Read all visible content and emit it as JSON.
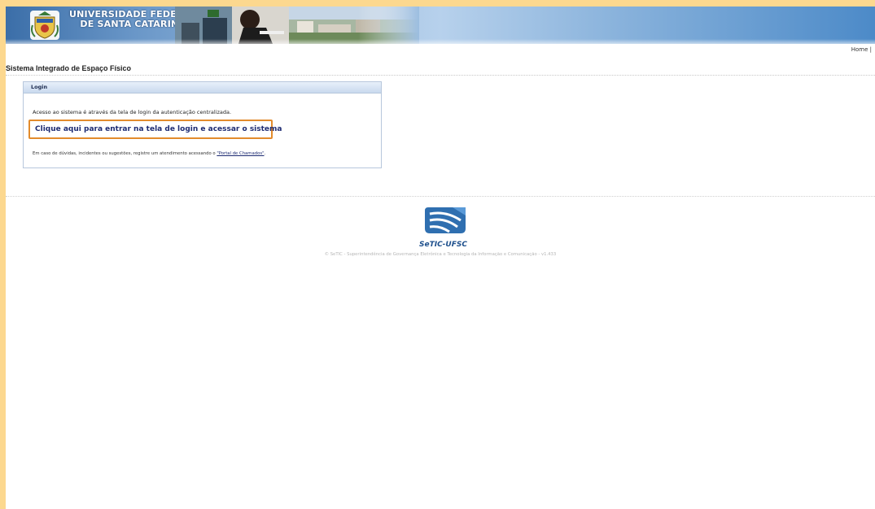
{
  "header": {
    "university_line1": "UNIVERSIDADE FEDERAL",
    "university_line2": "DE SANTA CATARINA",
    "home_link": "Home |"
  },
  "page": {
    "title": "Sistema Integrado de Espaço Físico"
  },
  "login": {
    "box_title": "Login",
    "info_text": "Acesso ao sistema é através da tela de login da autenticação centralizada.",
    "link_text": "Clique aqui para entrar na tela de login e acessar o sistema",
    "support_prefix": "Em caso de dúvidas, incidentes ou sugestões, registre um atendimento acessando o ",
    "support_link": "\"Portal de Chamados\"",
    "support_suffix": "."
  },
  "footer": {
    "logo_name": "SeTIC-UFSC",
    "copyright": "© SeTIC - Superintendência de Governança Eletrônica e Tecnologia da Informação e Comunicação - v1.433"
  },
  "colors": {
    "page_frame": "#fcd88f",
    "banner_blue": "#4c8ac8",
    "link_blue": "#1d2b72",
    "highlight_orange": "#e28b2c"
  }
}
